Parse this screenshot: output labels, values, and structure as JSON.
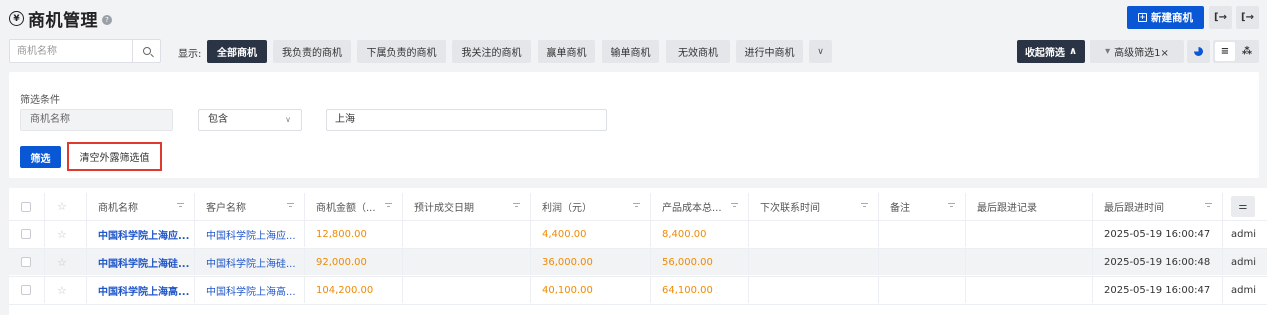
{
  "header": {
    "title": "商机管理",
    "new_button": "新建商机"
  },
  "toolbar": {
    "search_placeholder": "商机名称",
    "show_label": "显示:",
    "chips": [
      "全部商机",
      "我负责的商机",
      "下属负责的商机",
      "我关注的商机",
      "赢单商机",
      "输单商机",
      "无效商机",
      "进行中商机"
    ],
    "active_chip": "全部商机",
    "collapse_label": "收起筛选",
    "advanced_label": "高级筛选1×"
  },
  "filter": {
    "title": "筛选条件",
    "field": "商机名称",
    "operator": "包含",
    "value": "上海",
    "apply_label": "筛选",
    "clear_label": "清空外露筛选值"
  },
  "table": {
    "columns": [
      "商机名称",
      "客户名称",
      "商机金额（...",
      "预计成交日期",
      "利润（元）",
      "产品成本总...",
      "下次联系时间",
      "备注",
      "最后跟进记录",
      "最后跟进时间"
    ],
    "rows": [
      {
        "name": "中国科学院上海应...",
        "customer": "中国科学院上海应...",
        "amount": "12,800.00",
        "expected_date": "",
        "profit": "4,400.00",
        "cost": "8,400.00",
        "next_contact": "",
        "note": "",
        "last_record": "",
        "last_time": "2025-05-19 16:00:47",
        "owner": "admi"
      },
      {
        "name": "中国科学院上海硅...",
        "customer": "中国科学院上海硅...",
        "amount": "92,000.00",
        "expected_date": "",
        "profit": "36,000.00",
        "cost": "56,000.00",
        "next_contact": "",
        "note": "",
        "last_record": "",
        "last_time": "2025-05-19 16:00:48",
        "owner": "admi"
      },
      {
        "name": "中国科学院上海高...",
        "customer": "中国科学院上海高...",
        "amount": "104,200.00",
        "expected_date": "",
        "profit": "40,100.00",
        "cost": "64,100.00",
        "next_contact": "",
        "note": "",
        "last_record": "",
        "last_time": "2025-05-19 16:00:47",
        "owner": "admi"
      }
    ]
  },
  "colors": {
    "primary": "#0a57d6",
    "dark": "#2a3444",
    "link": "#1f56c8",
    "amount": "#f08a00",
    "highlight_border": "#e03a2e"
  }
}
